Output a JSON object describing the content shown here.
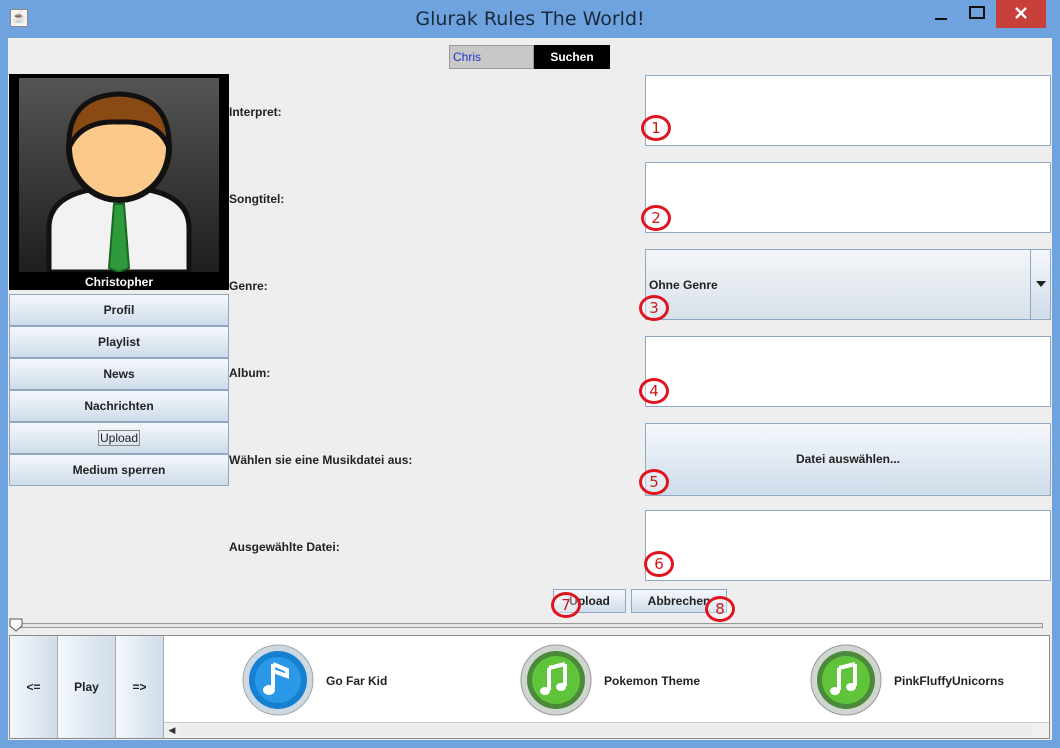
{
  "window": {
    "title": "Glurak Rules The World!"
  },
  "top_tags": {
    "user": "Chris",
    "search": "Suchen"
  },
  "profile": {
    "name": "Christopher"
  },
  "nav": [
    "Profil",
    "Playlist",
    "News",
    "Nachrichten",
    "Upload",
    "Medium sperren"
  ],
  "form": {
    "interpret_label": "Interpret:",
    "songtitel_label": "Songtitel:",
    "genre_label": "Genre:",
    "genre_value": "Ohne Genre",
    "album_label": "Album:",
    "file_choose_label": "Wählen sie eine Musikdatei aus:",
    "file_choose_button": "Datei auswählen...",
    "selected_file_label": "Ausgewählte Datei:",
    "upload_button": "Upload",
    "cancel_button": "Abbrechen"
  },
  "markers": [
    "1",
    "2",
    "3",
    "4",
    "5",
    "6",
    "7",
    "8"
  ],
  "player": {
    "prev": "<=",
    "play": "Play",
    "next": "=>",
    "songs": [
      {
        "title": "Go Far Kid",
        "icon": "music-note-blue-icon"
      },
      {
        "title": "Pokemon Theme",
        "icon": "music-note-green-icon"
      },
      {
        "title": "PinkFluffyUnicorns",
        "icon": "music-note-green-icon"
      }
    ],
    "seek_position": 0.0
  },
  "colors": {
    "marker_red": "#e0141e",
    "titlebar": "#6ea3e0",
    "close_red": "#c7403a"
  }
}
